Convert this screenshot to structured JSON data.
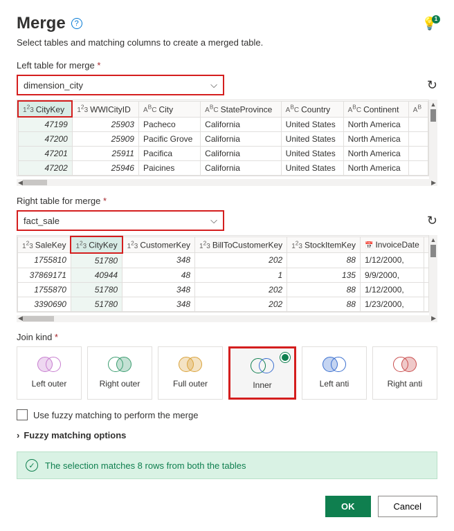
{
  "title": "Merge",
  "subtitle": "Select tables and matching columns to create a merged table.",
  "idea_badge": "1",
  "left": {
    "label": "Left table for merge",
    "dropdown": "dimension_city",
    "columns": [
      "CityKey",
      "WWICityID",
      "City",
      "StateProvince",
      "Country",
      "Continent"
    ],
    "coltypes": [
      "num",
      "num",
      "abc",
      "abc",
      "abc",
      "abc"
    ],
    "selectedCol": 0,
    "rows": [
      [
        "47199",
        "25903",
        "Pacheco",
        "California",
        "United States",
        "North America"
      ],
      [
        "47200",
        "25909",
        "Pacific Grove",
        "California",
        "United States",
        "North America"
      ],
      [
        "47201",
        "25911",
        "Pacifica",
        "California",
        "United States",
        "North America"
      ],
      [
        "47202",
        "25946",
        "Paicines",
        "California",
        "United States",
        "North America"
      ]
    ]
  },
  "right": {
    "label": "Right table for merge",
    "dropdown": "fact_sale",
    "columns": [
      "SaleKey",
      "CityKey",
      "CustomerKey",
      "BillToCustomerKey",
      "StockItemKey",
      "InvoiceDate"
    ],
    "coltypes": [
      "num",
      "num",
      "num",
      "num",
      "num",
      "date"
    ],
    "selectedCol": 1,
    "rows": [
      [
        "1755810",
        "51780",
        "348",
        "202",
        "88",
        "1/12/2000,"
      ],
      [
        "37869171",
        "40944",
        "48",
        "1",
        "135",
        "9/9/2000,"
      ],
      [
        "1755870",
        "51780",
        "348",
        "202",
        "88",
        "1/12/2000,"
      ],
      [
        "3390690",
        "51780",
        "348",
        "202",
        "88",
        "1/23/2000,"
      ]
    ]
  },
  "joinLabel": "Join kind",
  "joins": [
    "Left outer",
    "Right outer",
    "Full outer",
    "Inner",
    "Left anti",
    "Right anti"
  ],
  "joinSelected": 3,
  "fuzzyCheck": "Use fuzzy matching to perform the merge",
  "fuzzyOptions": "Fuzzy matching options",
  "status": "The selection matches 8 rows from both the tables",
  "buttons": {
    "ok": "OK",
    "cancel": "Cancel"
  }
}
